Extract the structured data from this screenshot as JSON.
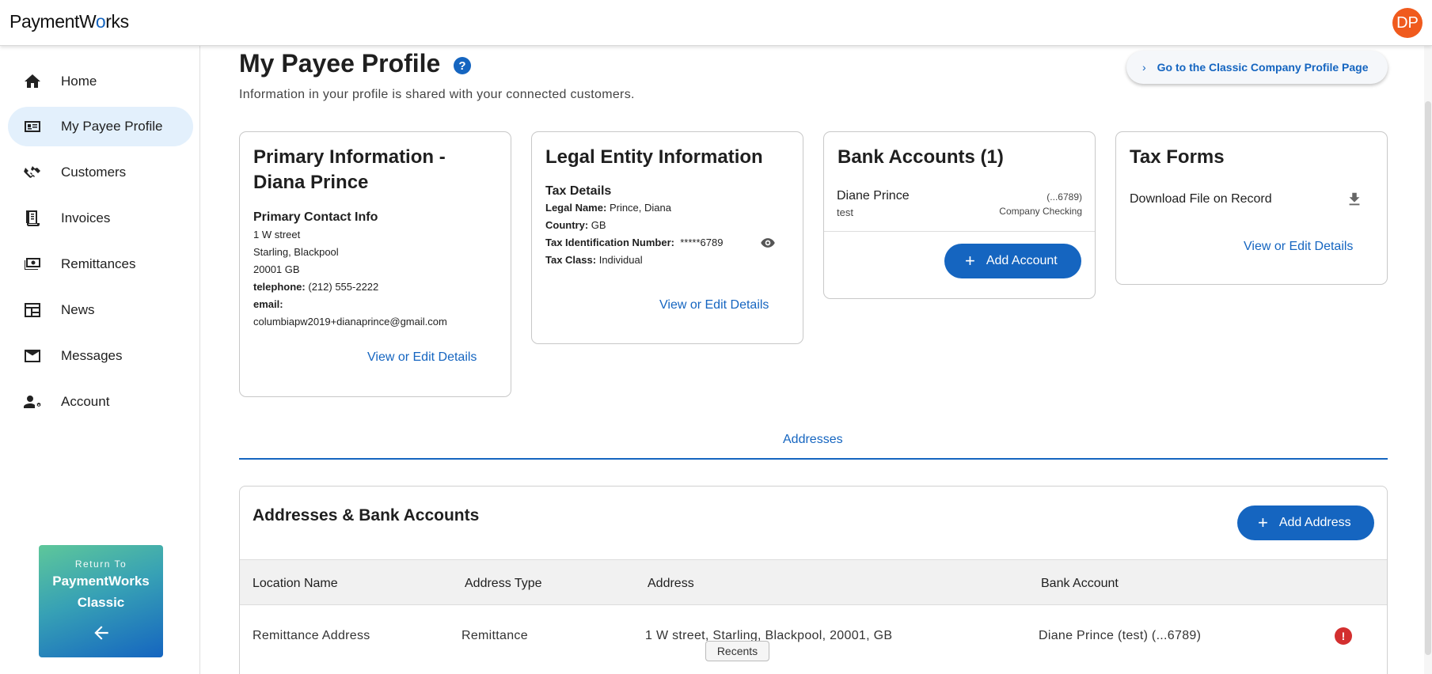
{
  "header": {
    "logo_prefix": "PaymentW",
    "logo_o": "o",
    "logo_suffix": "rks",
    "avatar_initials": "DP"
  },
  "sidebar": {
    "items": [
      {
        "label": "Home",
        "icon": "home-icon"
      },
      {
        "label": "My Payee Profile",
        "icon": "profile-card-icon"
      },
      {
        "label": "Customers",
        "icon": "handshake-icon"
      },
      {
        "label": "Invoices",
        "icon": "invoice-icon"
      },
      {
        "label": "Remittances",
        "icon": "money-icon"
      },
      {
        "label": "News",
        "icon": "newspaper-icon"
      },
      {
        "label": "Messages",
        "icon": "mail-icon"
      },
      {
        "label": "Account",
        "icon": "account-settings-icon"
      }
    ],
    "active_item": "My Payee Profile",
    "classic_small": "Return To",
    "classic_line1": "PaymentWorks",
    "classic_line2": "Classic"
  },
  "page": {
    "title": "My Payee Profile",
    "help": "?",
    "subtitle": "Information in your profile is shared with your connected customers.",
    "classic_link": "Go to the Classic Company Profile Page"
  },
  "cards": {
    "primary": {
      "title_line1": "Primary Information -",
      "title_line2": "Diana Prince",
      "contact_head": "Primary Contact Info",
      "addr1": "1 W street",
      "addr2": "Starling, Blackpool",
      "addr3": "20001 GB",
      "tel_label": "telephone:",
      "tel_value": "(212) 555-2222",
      "email_label": "email:",
      "email_value": "columbiapw2019+dianaprince@gmail.com",
      "link": "View or Edit Details"
    },
    "legal": {
      "title": "Legal Entity Information",
      "tax_head": "Tax Details",
      "legal_name_label": "Legal Name:",
      "legal_name_value": "Prince, Diana",
      "country_label": "Country:",
      "country_value": "GB",
      "tin_label": "Tax Identification Number:",
      "tin_value": "*****6789",
      "tax_class_label": "Tax Class:",
      "tax_class_value": "Individual",
      "link": "View or Edit Details"
    },
    "bank": {
      "title": "Bank Accounts (1)",
      "account_name": "Diane Prince",
      "account_nick": "test",
      "account_last4": "(...6789)",
      "account_type": "Company Checking",
      "add_button": "Add Account"
    },
    "tax": {
      "title": "Tax Forms",
      "download_label": "Download File on Record",
      "link": "View or Edit Details"
    }
  },
  "tabs": {
    "active": "Addresses"
  },
  "addresses": {
    "title": "Addresses & Bank Accounts",
    "add_button": "Add Address",
    "columns": [
      "Location Name",
      "Address Type",
      "Address",
      "Bank Account"
    ],
    "rows": [
      {
        "location": "Remittance Address",
        "type": "Remittance",
        "address": "1 W street, Starling, Blackpool, 20001, GB",
        "bank": "Diane Prince (test) (...6789)",
        "status": "!"
      }
    ]
  },
  "footer": {
    "recents": "Recents"
  },
  "colors": {
    "accent": "#1565c0",
    "avatar": "#f05a1d",
    "active_nav": "#e3f0fc",
    "error": "#d32f2f"
  }
}
